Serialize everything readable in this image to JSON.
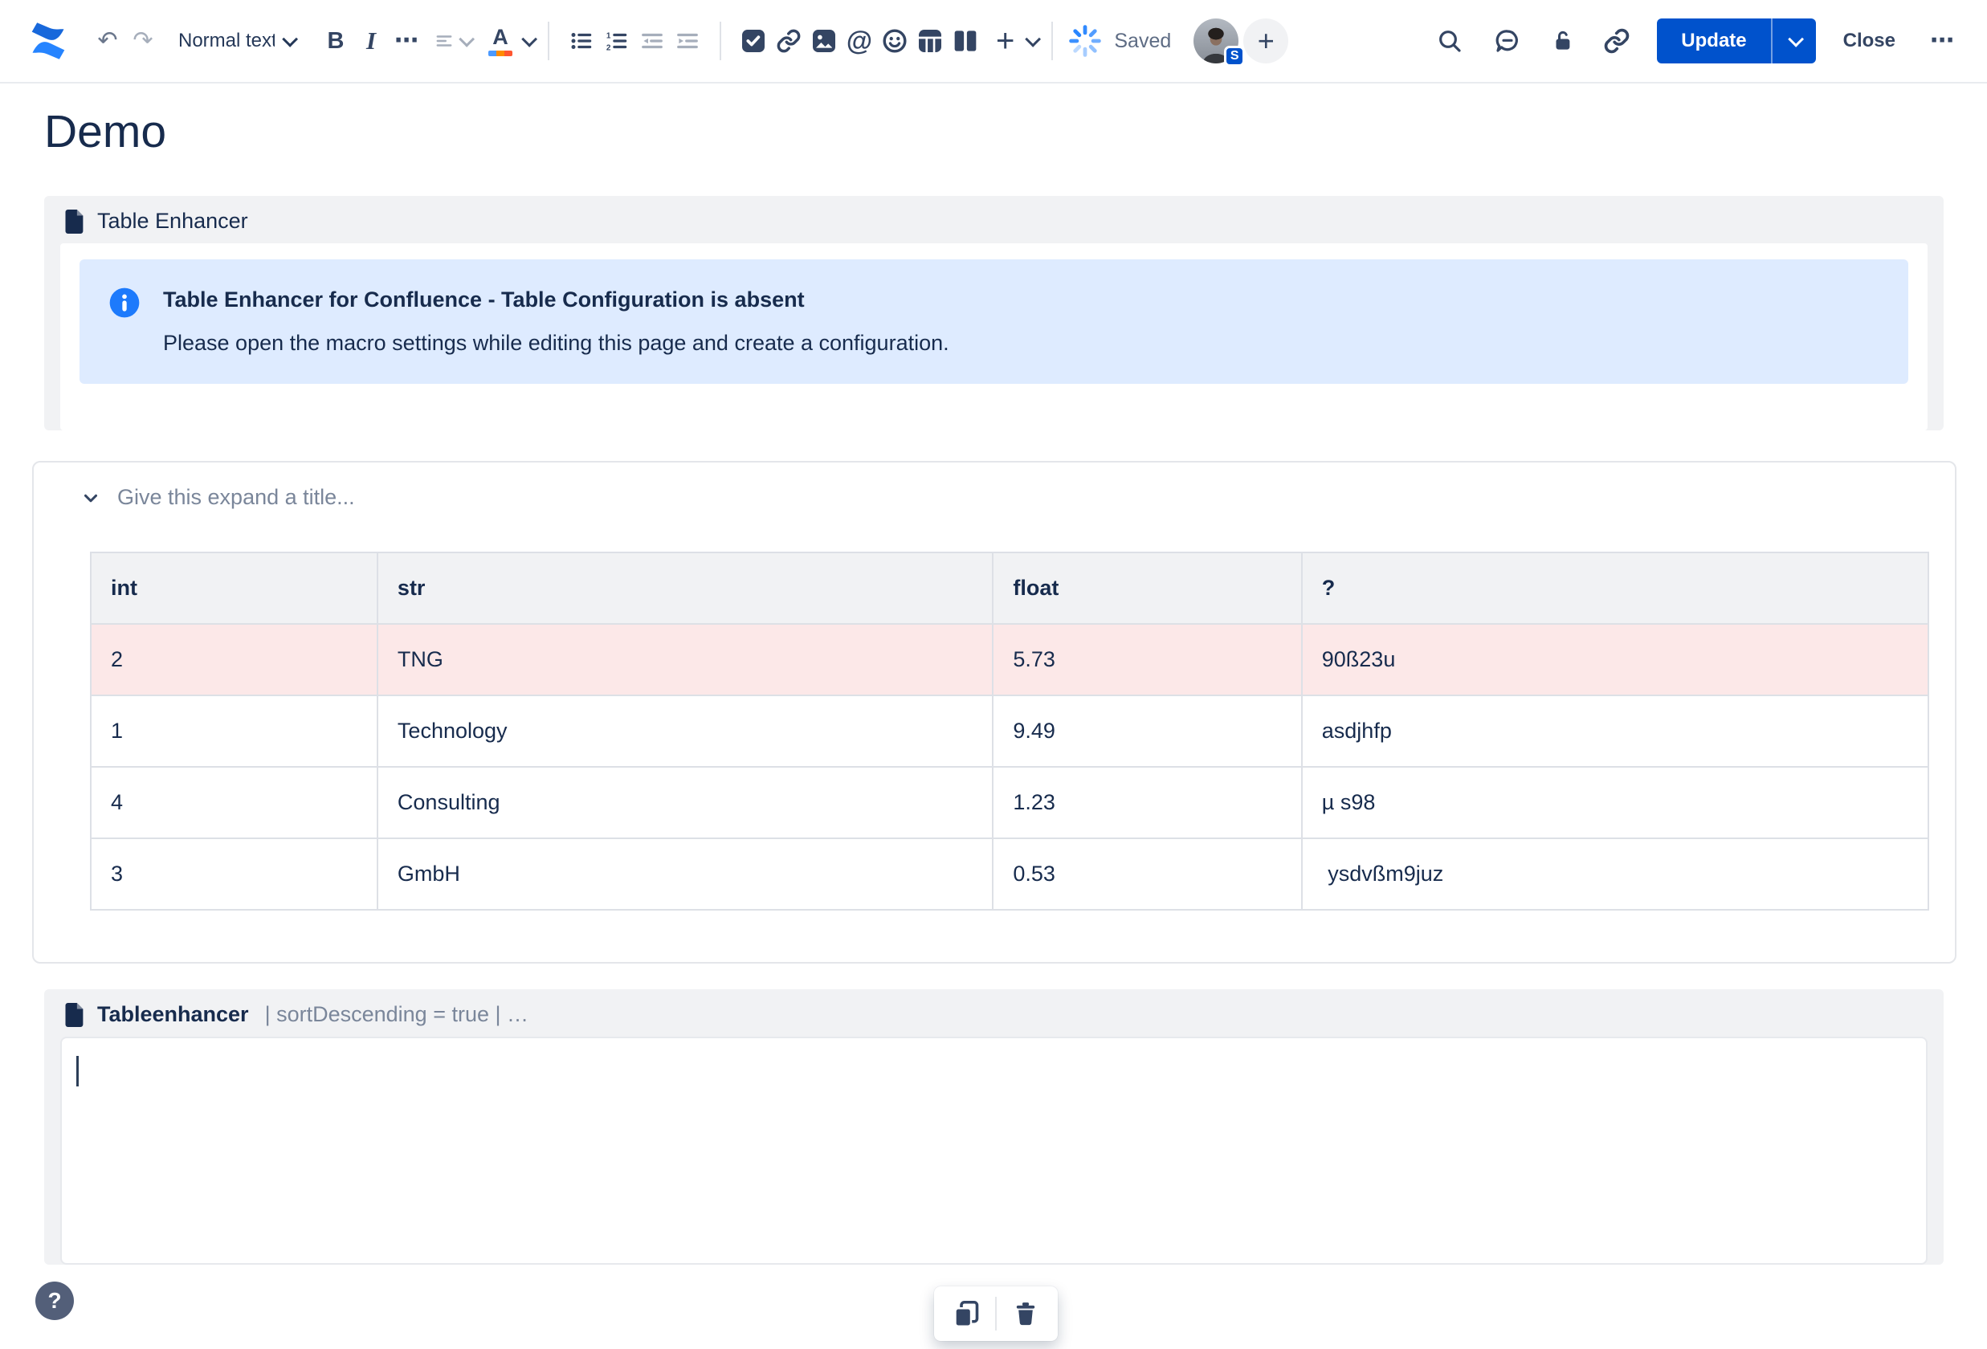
{
  "colors": {
    "accent_blue": "#0052CC",
    "info_panel_bg": "#DEEBFF",
    "info_icon_blue": "#1D7AFC",
    "macro_bg": "#F1F2F4",
    "table_header_bg": "#F1F2F4",
    "highlight_row_bg": "#FCE8E8",
    "text_dark": "#172B4D",
    "icon_navy": "#344563",
    "muted_gray": "#A6AEBB"
  },
  "toolbar": {
    "undo_glyph": "↶",
    "redo_glyph": "↷",
    "text_style_label": "Normal text",
    "bold_glyph": "B",
    "italic_glyph": "I",
    "more_glyph": "⋯",
    "color_glyph": "A",
    "mention_glyph": "@",
    "plus_glyph": "+",
    "saved_status": "Saved",
    "avatar_badge": "S",
    "update_label": "Update",
    "close_label": "Close"
  },
  "page": {
    "title": "Demo"
  },
  "table_enhancer_macro": {
    "title": "Table Enhancer",
    "info_title": "Table Enhancer for Confluence - Table Configuration is absent",
    "info_body": "Please open the macro settings while editing this page and create a configuration."
  },
  "expand": {
    "placeholder": "Give this expand a title...",
    "table": {
      "headers": [
        "int",
        "str",
        "float",
        "?"
      ],
      "col_widths": [
        "15.6%",
        "33.5%",
        "16.8%",
        "34.1%"
      ],
      "rows": [
        {
          "cells": [
            "2",
            "TNG",
            "5.73",
            "90ß23u"
          ],
          "highlight": true
        },
        {
          "cells": [
            "1",
            "Technology",
            "9.49",
            "asdjhfp"
          ],
          "highlight": false
        },
        {
          "cells": [
            "4",
            "Consulting",
            "1.23",
            "µ s98"
          ],
          "highlight": false
        },
        {
          "cells": [
            "3",
            "GmbH",
            "0.53",
            " ysdvßm9juz"
          ],
          "highlight": false
        }
      ]
    }
  },
  "tableenhancer_macro": {
    "title": "Tableenhancer",
    "params": "| sortDescending = true | …",
    "caret_glyph": "|"
  }
}
